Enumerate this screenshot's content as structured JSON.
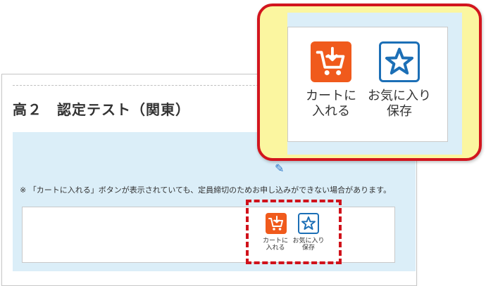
{
  "page": {
    "title": "高２　認定テスト（関東）",
    "note": "※ 「カートに入れる」ボタンが表示されていても、定員締切のためお申し込みができない場合があります。"
  },
  "buttons": {
    "cart_label_line1": "カートに",
    "cart_label_line2": "入れる",
    "save_label_line1": "お気に入り",
    "save_label_line2": "保存",
    "cart_icon": "cart-icon",
    "save_icon": "star-icon"
  },
  "colors": {
    "cart_button": "#f05a1c",
    "save_border": "#1c6fb6",
    "highlight": "#d0121b",
    "callout_bg": "#fbf6a0",
    "panel_bg": "#dbeef8"
  }
}
